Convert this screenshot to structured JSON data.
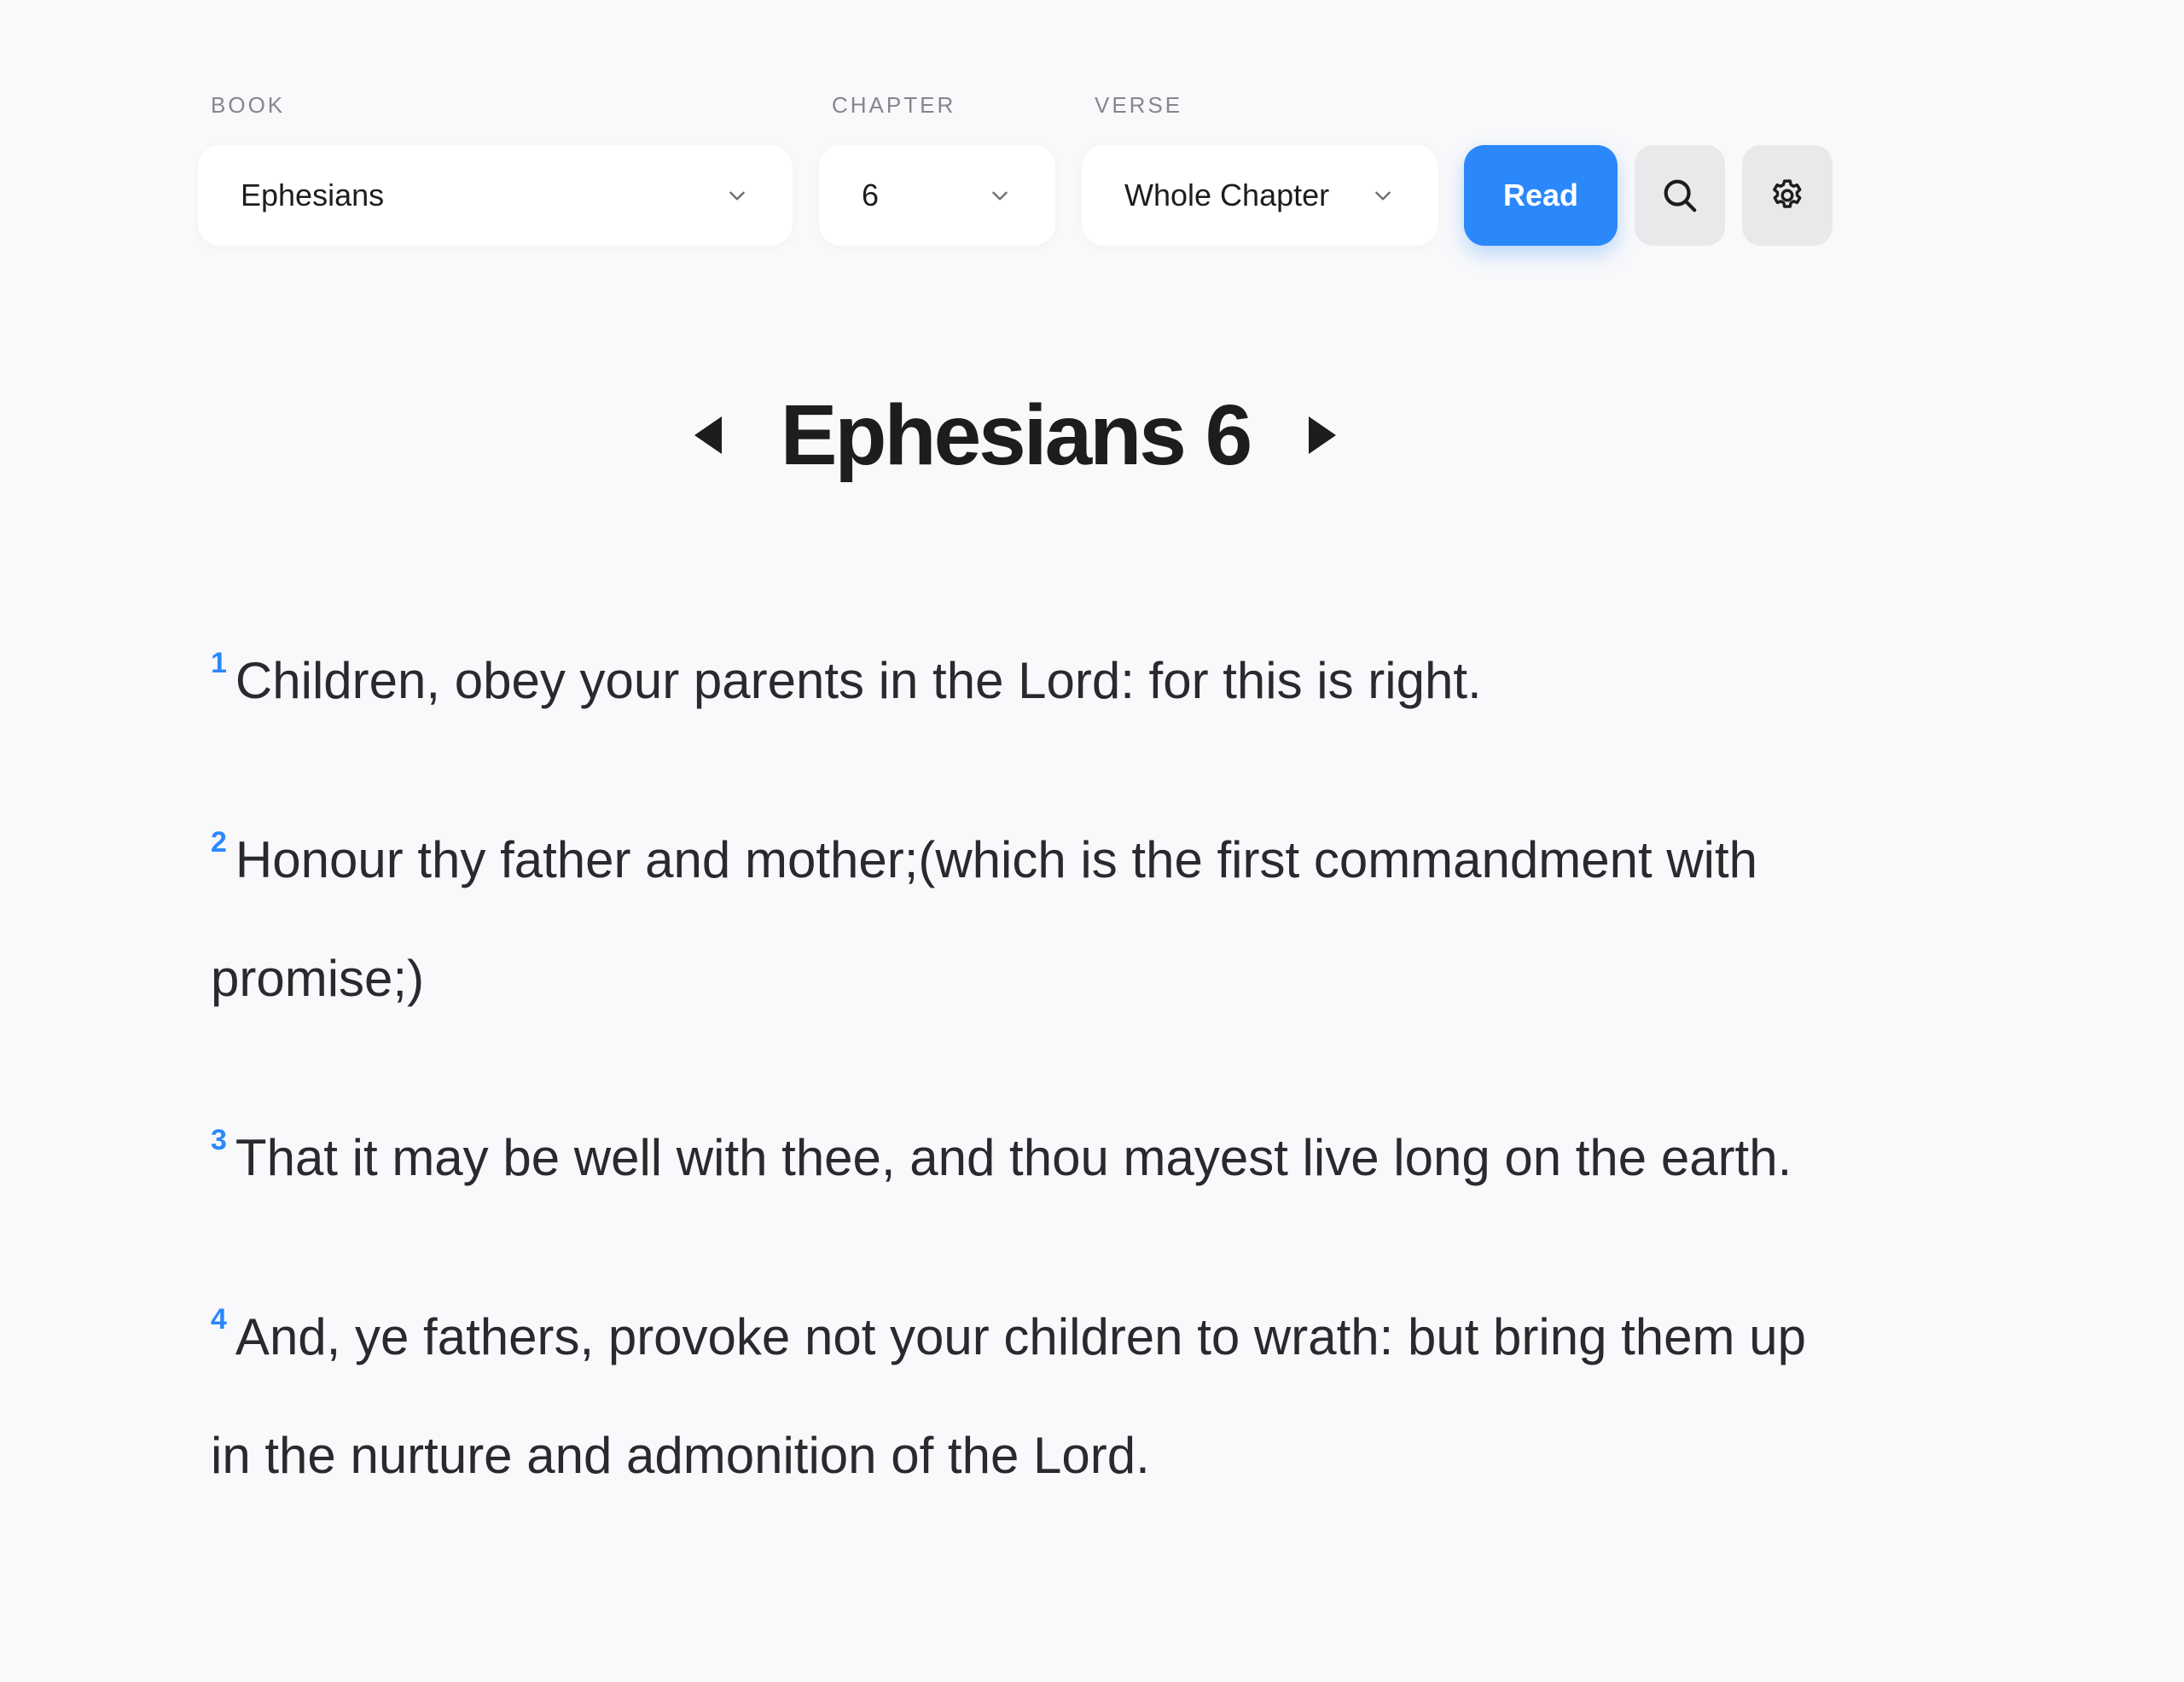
{
  "selectors": {
    "book": {
      "label": "BOOK",
      "value": "Ephesians"
    },
    "chapter": {
      "label": "CHAPTER",
      "value": "6"
    },
    "verse": {
      "label": "VERSE",
      "value": "Whole Chapter"
    }
  },
  "actions": {
    "read_label": "Read",
    "search_icon": "search-icon",
    "settings_icon": "gear-icon"
  },
  "heading": {
    "title": "Ephesians 6",
    "prev_icon": "triangle-left-icon",
    "next_icon": "triangle-right-icon"
  },
  "verses": [
    {
      "number": "1",
      "text": "Children, obey your parents in the Lord: for this is right."
    },
    {
      "number": "2",
      "text": "Honour thy father and mother;(which is the first commandment with promise;)"
    },
    {
      "number": "3",
      "text": "That it may be well with thee, and thou mayest live long on the earth."
    },
    {
      "number": "4",
      "text": "And, ye fathers, provoke not your children to wrath: but bring them up in the nurture and admonition of the Lord."
    }
  ],
  "colors": {
    "accent": "#2b88fb",
    "background": "#f9f9fb",
    "text": "#1d1d1f",
    "muted_label": "#86868b",
    "icon_button_bg": "#e9e9ec"
  }
}
